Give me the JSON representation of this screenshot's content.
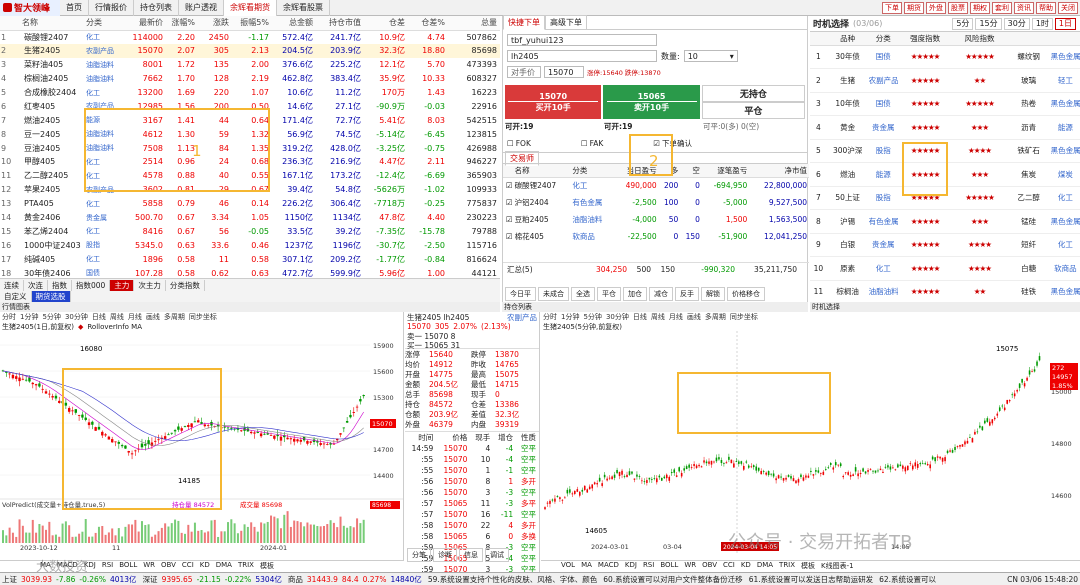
{
  "app": {
    "logo": "智大领峰"
  },
  "nav": [
    "首页",
    "行情报价",
    "持仓列表",
    "账户透视",
    "余辉看期货",
    "余辉看股票"
  ],
  "top_buttons": [
    "下单",
    "期货",
    "外盘",
    "股票",
    "期权",
    "套利",
    "资讯",
    "帮助",
    "关闭"
  ],
  "quote_table": {
    "headers": [
      "",
      "名称",
      "分类",
      "最新价",
      "涨幅%",
      "涨跌",
      "振幅5%",
      "总金额",
      "持仓市值",
      "仓差",
      "仓差%",
      "总量"
    ],
    "rows": [
      [
        "1",
        "碳酸锂2407",
        "化工",
        "114000",
        "2.20",
        "2450",
        "-1.17",
        "572.4亿",
        "241.7亿",
        "10.9亿",
        "4.74",
        "507862"
      ],
      [
        "2",
        "生猪2405",
        "农副产品",
        "15070",
        "2.07",
        "305",
        "2.13",
        "204.5亿",
        "203.9亿",
        "32.3亿",
        "18.80",
        "85698"
      ],
      [
        "3",
        "菜籽油405",
        "油脂油料",
        "8001",
        "1.72",
        "135",
        "2.00",
        "376.6亿",
        "225.2亿",
        "12.1亿",
        "5.70",
        "473393"
      ],
      [
        "4",
        "棕榈油2405",
        "油脂油料",
        "7662",
        "1.70",
        "128",
        "2.19",
        "462.8亿",
        "383.4亿",
        "35.9亿",
        "10.33",
        "608327"
      ],
      [
        "5",
        "合成橡胶2404",
        "化工",
        "13200",
        "1.69",
        "220",
        "1.07",
        "10.6亿",
        "11.2亿",
        "170万",
        "1.43",
        "16223"
      ],
      [
        "6",
        "红枣405",
        "农副产品",
        "12985",
        "1.56",
        "200",
        "0.50",
        "14.6亿",
        "27.1亿",
        "-90.9万",
        "-0.03",
        "22916"
      ],
      [
        "7",
        "燃油2405",
        "能源",
        "3167",
        "1.41",
        "44",
        "0.64",
        "171.4亿",
        "72.7亿",
        "5.41亿",
        "8.03",
        "542515"
      ],
      [
        "8",
        "豆一2405",
        "油脂油料",
        "4612",
        "1.30",
        "59",
        "1.32",
        "56.9亿",
        "74.5亿",
        "-5.14亿",
        "-6.45",
        "123815"
      ],
      [
        "9",
        "豆油2405",
        "油脂油料",
        "7508",
        "1.13",
        "84",
        "1.35",
        "319.2亿",
        "428.0亿",
        "-3.25亿",
        "-0.75",
        "426988"
      ],
      [
        "10",
        "甲醇405",
        "化工",
        "2514",
        "0.96",
        "24",
        "0.68",
        "236.3亿",
        "216.9亿",
        "4.47亿",
        "2.11",
        "946227"
      ],
      [
        "11",
        "乙二醇2405",
        "化工",
        "4578",
        "0.88",
        "40",
        "0.55",
        "167.1亿",
        "173.2亿",
        "-12.4亿",
        "-6.69",
        "365903"
      ],
      [
        "12",
        "苹果2405",
        "农副产品",
        "3602",
        "0.81",
        "29",
        "0.67",
        "39.4亿",
        "54.8亿",
        "-5626万",
        "-1.02",
        "109933"
      ],
      [
        "13",
        "PTA405",
        "化工",
        "5858",
        "0.79",
        "46",
        "0.14",
        "226.2亿",
        "306.4亿",
        "-7718万",
        "-0.25",
        "775837"
      ],
      [
        "14",
        "黄金2406",
        "贵金属",
        "500.70",
        "0.67",
        "3.34",
        "1.05",
        "1150亿",
        "1134亿",
        "47.8亿",
        "4.40",
        "230223"
      ],
      [
        "15",
        "苯乙烯2404",
        "化工",
        "8416",
        "0.67",
        "56",
        "-0.05",
        "33.5亿",
        "39.2亿",
        "-7.35亿",
        "-15.78",
        "79788"
      ],
      [
        "16",
        "1000中证2403",
        "股指",
        "5345.0",
        "0.63",
        "33.6",
        "0.46",
        "1237亿",
        "1196亿",
        "-30.7亿",
        "-2.50",
        "115716"
      ],
      [
        "17",
        "纯碱405",
        "化工",
        "1896",
        "0.58",
        "11",
        "0.58",
        "307.1亿",
        "209.2亿",
        "-1.77亿",
        "-0.84",
        "816624"
      ],
      [
        "18",
        "30年债2406",
        "国债",
        "107.28",
        "0.58",
        "0.62",
        "0.63",
        "472.7亿",
        "599.9亿",
        "5.96亿",
        "1.00",
        "44121"
      ]
    ]
  },
  "quote_tabs_row1": [
    "连续",
    "次连",
    "指数",
    "指数000",
    "主力",
    "次主力",
    "分类指数"
  ],
  "quote_tabs_row2": [
    "自定义",
    "期货选股"
  ],
  "trade": {
    "tabs": [
      "快捷下单",
      "高级下单"
    ],
    "account": "tbf_yuhui123",
    "contract": "lh2405",
    "qty_label": "数量:",
    "qty": "10",
    "price_label": "对手价",
    "price": "15070",
    "limit": "涨停:15640 跌停:13870",
    "buy": {
      "price": "15070",
      "label": "买开10手",
      "avail": "可开:19"
    },
    "sell": {
      "price": "15065",
      "label": "卖开10手",
      "avail": "可开:19"
    },
    "no_position": "无持仓",
    "close": "平仓",
    "closable": "可平:0(多) 0(空)",
    "opts": [
      "FOK",
      "FAK",
      "下单确认"
    ],
    "section_tab": "交易师",
    "pos_headers": [
      "",
      "名称",
      "分类",
      "当日盈亏",
      "多",
      "空",
      "逐笔盈亏",
      "净市值"
    ],
    "positions": [
      [
        "碳酸锂2407",
        "化工",
        "490,000",
        "200",
        "0",
        "-694,950",
        "22,800,000"
      ],
      [
        "沪铝2404",
        "有色金属",
        "-2,500",
        "100",
        "0",
        "-5,000",
        "9,527,500"
      ],
      [
        "豆粕2405",
        "油脂油料",
        "-4,000",
        "50",
        "0",
        "1,500",
        "1,563,500"
      ],
      [
        "棉花405",
        "软商品",
        "-22,500",
        "0",
        "150",
        "-51,900",
        "12,041,250"
      ]
    ],
    "summary": [
      "汇总(5)",
      "304,250",
      "500",
      "150",
      "-990,320",
      "35,211,750"
    ],
    "bottom_tabs": [
      "今日平",
      "未成合",
      "全选",
      "平仓",
      "加仓",
      "减仓",
      "反手",
      "解锁",
      "价格移仓"
    ],
    "footer_tab": "持仓列表"
  },
  "timing": {
    "title": "时机选择",
    "date": "(03/06)",
    "periods": [
      "5分",
      "15分",
      "30分",
      "1时",
      "1日"
    ],
    "headers": [
      "",
      "品种",
      "分类",
      "强度指数",
      "风险指数",
      "",
      ""
    ],
    "rows": [
      [
        "1",
        "30年债",
        "国债",
        "★★★★★",
        "★★★★★",
        "螺纹钢",
        "黑色金属"
      ],
      [
        "2",
        "生猪",
        "农副产品",
        "★★★★★",
        "★★",
        "玻璃",
        "轻工"
      ],
      [
        "3",
        "10年债",
        "国债",
        "★★★★★",
        "★★★★★",
        "热卷",
        "黑色金属"
      ],
      [
        "4",
        "黄金",
        "贵金属",
        "★★★★★",
        "★★★",
        "沥青",
        "能源"
      ],
      [
        "5",
        "300沪深",
        "股指",
        "★★★★★",
        "★★★★",
        "铁矿石",
        "黑色金属"
      ],
      [
        "6",
        "燃油",
        "能源",
        "★★★★★",
        "★★★",
        "焦炭",
        "煤炭"
      ],
      [
        "7",
        "50上证",
        "股指",
        "★★★★★",
        "★★★★★",
        "乙二醇",
        "化工"
      ],
      [
        "8",
        "沪锡",
        "有色金属",
        "★★★★★",
        "★★★",
        "锰硅",
        "黑色金属"
      ],
      [
        "9",
        "白银",
        "贵金属",
        "★★★★★",
        "★★★★",
        "短纤",
        "化工"
      ],
      [
        "10",
        "原素",
        "化工",
        "★★★★★",
        "★★★★",
        "白糖",
        "软商品"
      ],
      [
        "11",
        "棕榈油",
        "油脂油料",
        "★★★★★",
        "★★",
        "硅铁",
        "黑色金属"
      ]
    ],
    "footer_tab": "时机选择"
  },
  "left_chart": {
    "title": "生猪2405(1日,前复权)",
    "tools": [
      "分时",
      "1分钟",
      "5分钟",
      "30分钟",
      "日线",
      "周线",
      "月线",
      "画线",
      "多周期",
      "同步坐标"
    ],
    "legend": "RolloverInfo MA",
    "annotations": [
      "16080",
      "14185"
    ],
    "yticks": [
      "15900",
      "15600",
      "15300",
      "15000",
      "14700",
      "14400"
    ],
    "last_price": "15070",
    "indicator": "VolPredict(成交量+持仓量,true,5)",
    "oi": "持仓量 84572",
    "vol": "成交量 85698",
    "vol_tick": "85698",
    "xdates": [
      "2023-10-12",
      "11",
      "2024-01"
    ],
    "ind_tabs": [
      "MA",
      "MACD",
      "KDJ",
      "RSI",
      "BOLL",
      "WR",
      "OBV",
      "CCI",
      "KD",
      "DMA",
      "TRIX",
      "模板"
    ],
    "highlight": "1"
  },
  "quote_box": {
    "header": "生猪2405 lh2405",
    "cat": "农副产品",
    "last": "15070",
    "chg": "305",
    "pct": "2.07%",
    "pct2": "(2.13%)",
    "sell1": "卖一 15070 8",
    "buy1": "买一 15065 31",
    "grid": [
      [
        "涨停",
        "15640",
        "跌停",
        "13870"
      ],
      [
        "均价",
        "14912",
        "昨收",
        "14765"
      ],
      [
        "开盘",
        "14775",
        "最高",
        "15075"
      ],
      [
        "金额",
        "204.5亿",
        "最低",
        "14715"
      ],
      [
        "总手",
        "85698",
        "现手",
        "0"
      ],
      [
        "持仓",
        "84572",
        "仓差",
        "13386"
      ],
      [
        "仓额",
        "203.9亿",
        "差值",
        "32.3亿"
      ],
      [
        "外盘",
        "46379",
        "内盘",
        "39319"
      ]
    ],
    "tick_headers": [
      "时间",
      "价格",
      "现手",
      "增仓",
      "性质"
    ],
    "ticks": [
      [
        "14:59",
        "15070",
        "4",
        "-4",
        "空平"
      ],
      [
        ":55",
        "15070",
        "10",
        "-4",
        "空平"
      ],
      [
        ":55",
        "15070",
        "1",
        "-1",
        "空平"
      ],
      [
        ":56",
        "15070",
        "8",
        "1",
        "多开"
      ],
      [
        ":56",
        "15070",
        "3",
        "-3",
        "空平"
      ],
      [
        ":57",
        "15065",
        "11",
        "-3",
        "多平"
      ],
      [
        ":57",
        "15070",
        "16",
        "-11",
        "空平"
      ],
      [
        ":58",
        "15070",
        "22",
        "4",
        "多开"
      ],
      [
        ":58",
        "15065",
        "6",
        "0",
        "多换"
      ],
      [
        ":59",
        "15065",
        "8",
        "-3",
        "空平"
      ],
      [
        ":59",
        "15065",
        "5",
        "-4",
        "空平"
      ],
      [
        ":59",
        "15070",
        "3",
        "-3",
        "空平"
      ]
    ],
    "tabs": [
      "分笔",
      "诊断",
      "信息",
      "调试"
    ]
  },
  "right_chart": {
    "title": "生猪2405(5分钟,前复权)",
    "tools": [
      "分时",
      "1分钟",
      "5分钟",
      "30分钟",
      "日线",
      "周线",
      "月线",
      "画线",
      "多周期",
      "同步坐标"
    ],
    "annotations": [
      "15075",
      "14605"
    ],
    "yticks": [
      "15000",
      "14800",
      "14600"
    ],
    "price_tag": [
      "272",
      "14957",
      "1.85%"
    ],
    "xdates": [
      "2024-03-01",
      "03-04",
      "14:05"
    ],
    "ind_tabs": [
      "VOL",
      "MA",
      "MACD",
      "KDJ",
      "RSI",
      "BOLL",
      "WR",
      "OBV",
      "CCI",
      "KD",
      "DMA",
      "TRIX",
      "模板"
    ],
    "footer": "K线图表-1",
    "selected_date": "2024-03-04 14:05",
    "highlight": "2"
  },
  "statusbar": {
    "items": [
      {
        "t": "上证",
        "v": "3039.93",
        "c": "-7.86",
        "p": "-0.26%",
        "a": "4013亿"
      },
      {
        "t": "深证",
        "v": "9395.65",
        "c": "-21.15",
        "p": "-0.22%",
        "a": "5304亿"
      },
      {
        "t": "商品",
        "v": "31443.9",
        "c": "84.4",
        "p": "0.27%",
        "a": "14840亿"
      }
    ],
    "messages": [
      "59.系统设置支持个性化的皮肤、风格、字体、颜色",
      "60.系统设置可以对用户文件整体备份迁移",
      "61.系统设置可以发送日志帮助运研发",
      "62.系统设置可以"
    ],
    "clock": "CN 03/06 15:48:20"
  },
  "watermark": "公众号 · 交易开拓者TB",
  "watermark2": "大数投资",
  "colors": {
    "up": "#e00000",
    "down": "#009900",
    "accent": "#c00000",
    "highlight": "#f5b731",
    "buy": "#d93a3a",
    "sell": "#2a9a4a"
  }
}
